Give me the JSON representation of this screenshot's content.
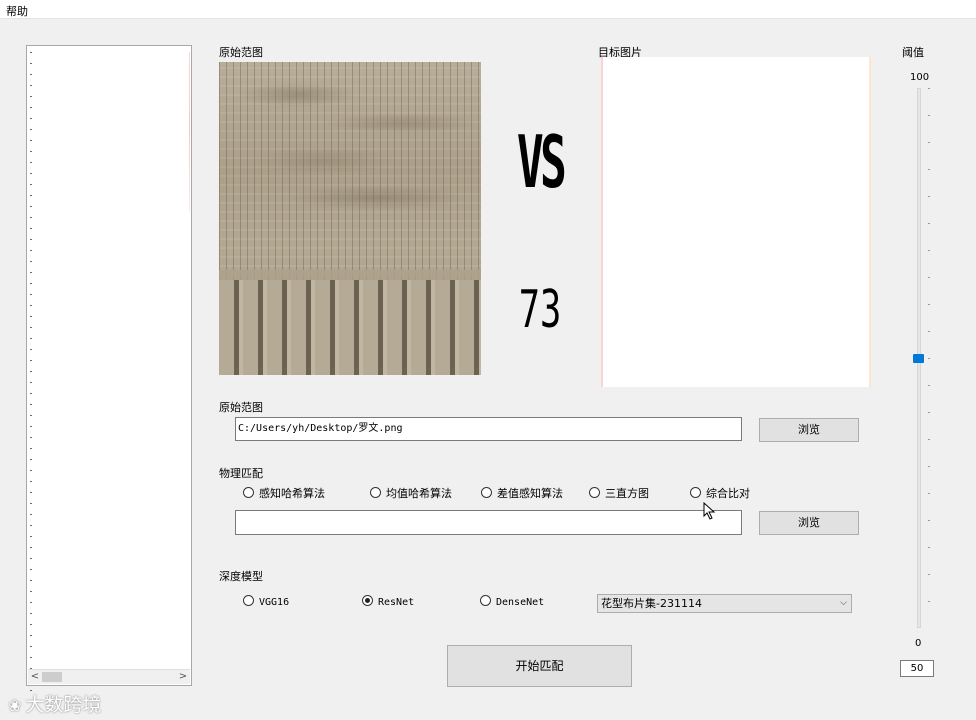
{
  "menu": {
    "help": "帮助"
  },
  "list_panel": {
    "scroll_left": "<",
    "scroll_right": ">"
  },
  "source_image": {
    "label": "原始范图"
  },
  "versus_text": "VS",
  "match_score": "73",
  "target_image": {
    "label": "目标图片"
  },
  "threshold": {
    "label": "阈值",
    "max": "100",
    "min": "0",
    "value": "50",
    "level": 0.5
  },
  "path_section": {
    "label": "原始范图",
    "path_value": "C:/Users/yh/Desktop/罗文.png",
    "browse_label": "浏览"
  },
  "physical_match": {
    "label": "物理匹配",
    "options": [
      "感知哈希算法",
      "均值哈希算法",
      "差值感知算法",
      "三直方图",
      "综合比对"
    ],
    "path_value": "",
    "browse_label": "浏览"
  },
  "deep_model": {
    "label": "深度模型",
    "options": [
      "VGG16",
      "ResNet",
      "DenseNet"
    ],
    "selected": "ResNet",
    "dataset_selected": "花型布片集-231114"
  },
  "start_button": "开始匹配",
  "watermark": "大数跨境"
}
